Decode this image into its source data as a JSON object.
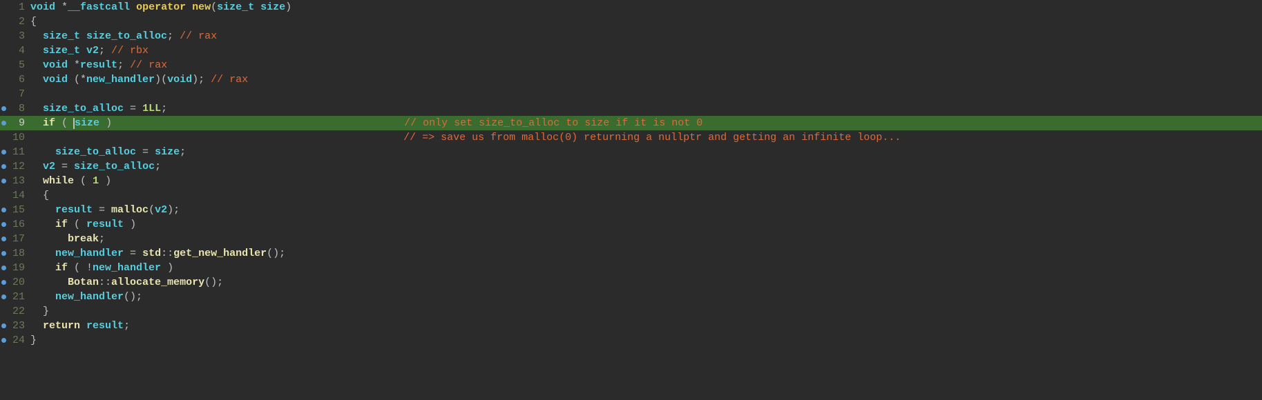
{
  "lines": [
    {
      "n": "1",
      "dot": false,
      "hl": false,
      "segments": [
        {
          "t": "void",
          "c": "kw-type"
        },
        {
          "t": " *",
          "c": "kw-op"
        },
        {
          "t": "__fastcall ",
          "c": "kw-type"
        },
        {
          "t": "operator new",
          "c": "kw-func"
        },
        {
          "t": "(",
          "c": "kw-paren"
        },
        {
          "t": "size_t size",
          "c": "kw-type"
        },
        {
          "t": ")",
          "c": "kw-paren"
        }
      ]
    },
    {
      "n": "2",
      "dot": false,
      "hl": false,
      "segments": [
        {
          "t": "{",
          "c": "kw-brace"
        }
      ]
    },
    {
      "n": "3",
      "dot": false,
      "hl": false,
      "segments": [
        {
          "t": "  ",
          "c": ""
        },
        {
          "t": "size_t size_to_alloc",
          "c": "kw-type"
        },
        {
          "t": "; ",
          "c": "kw-op"
        },
        {
          "t": "// rax",
          "c": "kw-comment"
        }
      ]
    },
    {
      "n": "4",
      "dot": false,
      "hl": false,
      "segments": [
        {
          "t": "  ",
          "c": ""
        },
        {
          "t": "size_t v2",
          "c": "kw-type"
        },
        {
          "t": "; ",
          "c": "kw-op"
        },
        {
          "t": "// rbx",
          "c": "kw-comment"
        }
      ]
    },
    {
      "n": "5",
      "dot": false,
      "hl": false,
      "segments": [
        {
          "t": "  ",
          "c": ""
        },
        {
          "t": "void",
          "c": "kw-type"
        },
        {
          "t": " *",
          "c": "kw-op"
        },
        {
          "t": "result",
          "c": "kw-type"
        },
        {
          "t": "; ",
          "c": "kw-op"
        },
        {
          "t": "// rax",
          "c": "kw-comment"
        }
      ]
    },
    {
      "n": "6",
      "dot": false,
      "hl": false,
      "segments": [
        {
          "t": "  ",
          "c": ""
        },
        {
          "t": "void",
          "c": "kw-type"
        },
        {
          "t": " (*",
          "c": "kw-op"
        },
        {
          "t": "new_handler",
          "c": "kw-type"
        },
        {
          "t": ")(",
          "c": "kw-op"
        },
        {
          "t": "void",
          "c": "kw-type"
        },
        {
          "t": "); ",
          "c": "kw-op"
        },
        {
          "t": "// rax",
          "c": "kw-comment"
        }
      ]
    },
    {
      "n": "7",
      "dot": false,
      "hl": false,
      "segments": []
    },
    {
      "n": "8",
      "dot": true,
      "hl": false,
      "segments": [
        {
          "t": "  ",
          "c": ""
        },
        {
          "t": "size_to_alloc",
          "c": "kw-var"
        },
        {
          "t": " = ",
          "c": "kw-op"
        },
        {
          "t": "1LL",
          "c": "kw-num"
        },
        {
          "t": ";",
          "c": "kw-op"
        }
      ]
    },
    {
      "n": "9",
      "dot": true,
      "hl": true,
      "comment": "// only set size_to_alloc to size if it is not 0",
      "segments": [
        {
          "t": "  ",
          "c": ""
        },
        {
          "t": "if",
          "c": "kw-keyword"
        },
        {
          "t": " ( ",
          "c": "kw-paren"
        },
        {
          "cursor": true
        },
        {
          "t": "size",
          "c": "kw-var"
        },
        {
          "t": " )",
          "c": "kw-paren"
        }
      ]
    },
    {
      "n": "10",
      "dot": false,
      "hl": false,
      "comment": "// => save us from malloc(0) returning a nullptr and getting an infinite loop...",
      "segments": []
    },
    {
      "n": "11",
      "dot": true,
      "hl": false,
      "segments": [
        {
          "t": "    ",
          "c": ""
        },
        {
          "t": "size_to_alloc",
          "c": "kw-var"
        },
        {
          "t": " = ",
          "c": "kw-op"
        },
        {
          "t": "size",
          "c": "kw-var"
        },
        {
          "t": ";",
          "c": "kw-op"
        }
      ]
    },
    {
      "n": "12",
      "dot": true,
      "hl": false,
      "segments": [
        {
          "t": "  ",
          "c": ""
        },
        {
          "t": "v2",
          "c": "kw-var"
        },
        {
          "t": " = ",
          "c": "kw-op"
        },
        {
          "t": "size_to_alloc",
          "c": "kw-var"
        },
        {
          "t": ";",
          "c": "kw-op"
        }
      ]
    },
    {
      "n": "13",
      "dot": true,
      "hl": false,
      "segments": [
        {
          "t": "  ",
          "c": ""
        },
        {
          "t": "while",
          "c": "kw-keyword"
        },
        {
          "t": " ( ",
          "c": "kw-paren"
        },
        {
          "t": "1",
          "c": "kw-num"
        },
        {
          "t": " )",
          "c": "kw-paren"
        }
      ]
    },
    {
      "n": "14",
      "dot": false,
      "hl": false,
      "segments": [
        {
          "t": "  {",
          "c": "kw-brace"
        }
      ]
    },
    {
      "n": "15",
      "dot": true,
      "hl": false,
      "segments": [
        {
          "t": "    ",
          "c": ""
        },
        {
          "t": "result",
          "c": "kw-var"
        },
        {
          "t": " = ",
          "c": "kw-op"
        },
        {
          "t": "malloc",
          "c": "kw-call"
        },
        {
          "t": "(",
          "c": "kw-paren"
        },
        {
          "t": "v2",
          "c": "kw-var"
        },
        {
          "t": ");",
          "c": "kw-paren"
        }
      ]
    },
    {
      "n": "16",
      "dot": true,
      "hl": false,
      "segments": [
        {
          "t": "    ",
          "c": ""
        },
        {
          "t": "if",
          "c": "kw-keyword"
        },
        {
          "t": " ( ",
          "c": "kw-paren"
        },
        {
          "t": "result",
          "c": "kw-var"
        },
        {
          "t": " )",
          "c": "kw-paren"
        }
      ]
    },
    {
      "n": "17",
      "dot": true,
      "hl": false,
      "segments": [
        {
          "t": "      ",
          "c": ""
        },
        {
          "t": "break",
          "c": "kw-keyword"
        },
        {
          "t": ";",
          "c": "kw-op"
        }
      ]
    },
    {
      "n": "18",
      "dot": true,
      "hl": false,
      "segments": [
        {
          "t": "    ",
          "c": ""
        },
        {
          "t": "new_handler",
          "c": "kw-var"
        },
        {
          "t": " = ",
          "c": "kw-op"
        },
        {
          "t": "std",
          "c": "kw-call"
        },
        {
          "t": "::",
          "c": "kw-op"
        },
        {
          "t": "get_new_handler",
          "c": "kw-call"
        },
        {
          "t": "();",
          "c": "kw-paren"
        }
      ]
    },
    {
      "n": "19",
      "dot": true,
      "hl": false,
      "segments": [
        {
          "t": "    ",
          "c": ""
        },
        {
          "t": "if",
          "c": "kw-keyword"
        },
        {
          "t": " ( !",
          "c": "kw-paren"
        },
        {
          "t": "new_handler",
          "c": "kw-var"
        },
        {
          "t": " )",
          "c": "kw-paren"
        }
      ]
    },
    {
      "n": "20",
      "dot": true,
      "hl": false,
      "segments": [
        {
          "t": "      ",
          "c": ""
        },
        {
          "t": "Botan",
          "c": "kw-call"
        },
        {
          "t": "::",
          "c": "kw-op"
        },
        {
          "t": "allocate_memory",
          "c": "kw-call"
        },
        {
          "t": "();",
          "c": "kw-paren"
        }
      ]
    },
    {
      "n": "21",
      "dot": true,
      "hl": false,
      "segments": [
        {
          "t": "    ",
          "c": ""
        },
        {
          "t": "new_handler",
          "c": "kw-var"
        },
        {
          "t": "();",
          "c": "kw-paren"
        }
      ]
    },
    {
      "n": "22",
      "dot": false,
      "hl": false,
      "segments": [
        {
          "t": "  }",
          "c": "kw-brace"
        }
      ]
    },
    {
      "n": "23",
      "dot": true,
      "hl": false,
      "segments": [
        {
          "t": "  ",
          "c": ""
        },
        {
          "t": "return",
          "c": "kw-keyword"
        },
        {
          "t": " ",
          "c": ""
        },
        {
          "t": "result",
          "c": "kw-var"
        },
        {
          "t": ";",
          "c": "kw-op"
        }
      ]
    },
    {
      "n": "24",
      "dot": true,
      "hl": false,
      "segments": [
        {
          "t": "}",
          "c": "kw-brace"
        }
      ]
    }
  ],
  "comment_col": 60
}
